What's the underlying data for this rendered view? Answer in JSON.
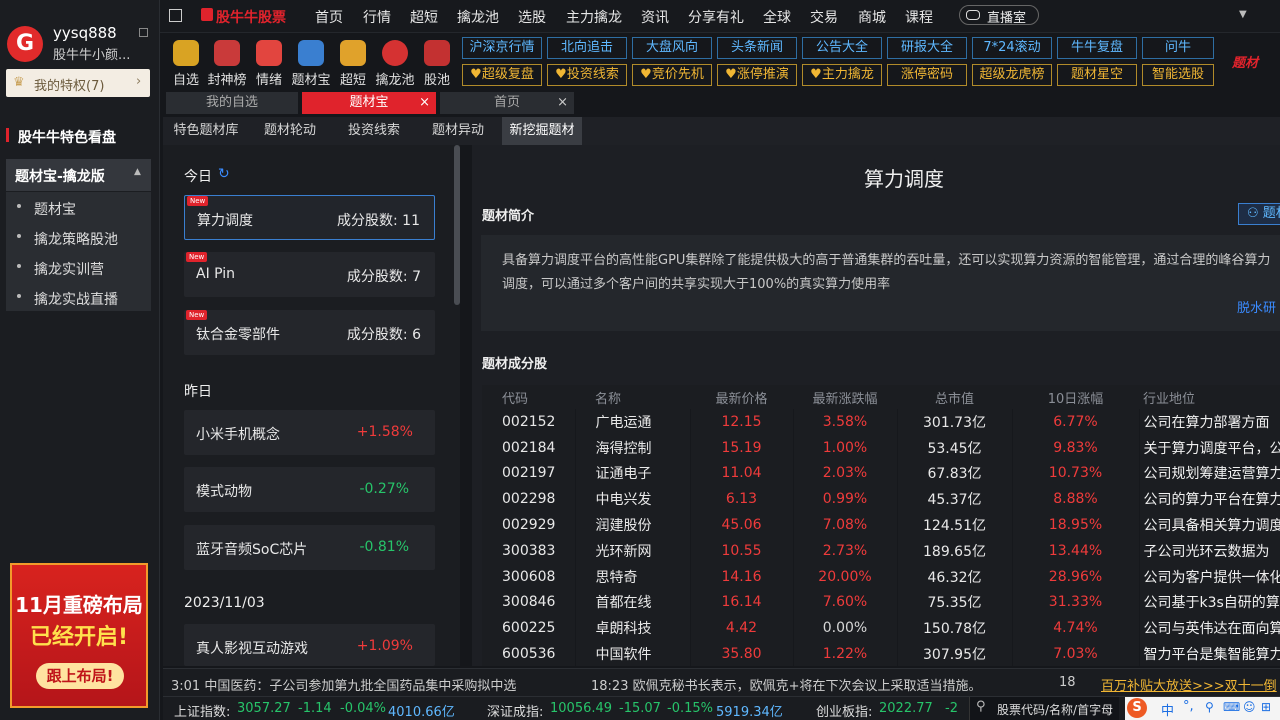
{
  "user": {
    "name": "yysq888",
    "subtitle": "股牛牛小颜...",
    "privilege": "我的特权(7)"
  },
  "sidebar": {
    "section_title": "股牛牛特色看盘",
    "group": "题材宝-擒龙版",
    "items": [
      "题材宝",
      "擒龙策略股池",
      "擒龙实训营",
      "擒龙实战直播"
    ]
  },
  "ad": {
    "line1": "11月重磅布局",
    "line2": "已经开启!",
    "button": "跟上布局!"
  },
  "brand": "股牛牛股票",
  "nav": [
    "首页",
    "行情",
    "超短",
    "擒龙池",
    "选股",
    "主力擒龙",
    "资讯",
    "分享有礼",
    "全球",
    "交易",
    "商城",
    "课程"
  ],
  "live": "直播室",
  "quick": [
    "自选",
    "封神榜",
    "情绪",
    "题材宝",
    "超短",
    "擒龙池",
    "股池"
  ],
  "blue_buttons": [
    "沪深京行情",
    "北向追击",
    "大盘风向",
    "头条新闻",
    "公告大全",
    "研报大全",
    "7*24滚动",
    "牛牛复盘",
    "问牛"
  ],
  "gold_buttons": [
    "超级复盘",
    "投资线索",
    "竞价先机",
    "涨停推演",
    "主力擒龙",
    "涨停密码",
    "超级龙虎榜",
    "题材星空",
    "智能选股"
  ],
  "brand_tag": "题材",
  "tabs": [
    "我的自选",
    "题材宝",
    "首页"
  ],
  "subtabs": [
    "特色题材库",
    "题材轮动",
    "投资线索",
    "题材异动",
    "新挖掘题材"
  ],
  "list": {
    "today_label": "今日",
    "today": [
      {
        "name": "算力调度",
        "count": "成分股数: 11",
        "badge": "New"
      },
      {
        "name": "AI Pin",
        "count": "成分股数: 7",
        "badge": "New"
      },
      {
        "name": "钛合金零部件",
        "count": "成分股数: 6",
        "badge": "New"
      }
    ],
    "yesterday_label": "昨日",
    "yesterday": [
      {
        "name": "小米手机概念",
        "change": "+1.58%"
      },
      {
        "name": "模式动物",
        "change": "-0.27%"
      },
      {
        "name": "蓝牙音频SoC芯片",
        "change": "-0.81%"
      }
    ],
    "date_label": "2023/11/03",
    "dated": [
      {
        "name": "真人影视互动游戏",
        "change": "+1.09%"
      }
    ]
  },
  "detail": {
    "title": "算力调度",
    "intro_label": "题材简介",
    "intro_tag": "题材",
    "intro_text": "具备算力调度平台的高性能GPU集群除了能提供极大的高于普通集群的吞吐量，还可以实现算力资源的智能管理，通过合理的峰谷算力调度，可以通过多个客户间的共享实现大于100%的真实算力使用率",
    "intro_source": "脱水研",
    "stocks_label": "题材成分股",
    "columns": [
      "代码",
      "名称",
      "最新价格",
      "最新涨跌幅",
      "总市值",
      "10日涨幅",
      "行业地位"
    ],
    "rows": [
      [
        "002152",
        "广电运通",
        "12.15",
        "3.58%",
        "301.73亿",
        "6.77%",
        "公司在算力部署方面"
      ],
      [
        "002184",
        "海得控制",
        "15.19",
        "1.00%",
        "53.45亿",
        "9.83%",
        "关于算力调度平台，公"
      ],
      [
        "002197",
        "证通电子",
        "11.04",
        "2.03%",
        "67.83亿",
        "10.73%",
        "公司规划筹建运营算力"
      ],
      [
        "002298",
        "中电兴发",
        "6.13",
        "0.99%",
        "45.37亿",
        "8.88%",
        "公司的算力平台在算力"
      ],
      [
        "002929",
        "润建股份",
        "45.06",
        "7.08%",
        "124.51亿",
        "18.95%",
        "公司具备相关算力调度"
      ],
      [
        "300383",
        "光环新网",
        "10.55",
        "2.73%",
        "189.65亿",
        "13.44%",
        "子公司光环云数据为"
      ],
      [
        "300608",
        "思特奇",
        "14.16",
        "20.00%",
        "46.32亿",
        "28.96%",
        "公司为客户提供一体化"
      ],
      [
        "300846",
        "首都在线",
        "16.14",
        "7.60%",
        "75.35亿",
        "31.33%",
        "公司基于k3s自研的算"
      ],
      [
        "600225",
        "卓朗科技",
        "4.42",
        "0.00%",
        "150.78亿",
        "4.74%",
        "公司与英伟达在面向算"
      ],
      [
        "600536",
        "中国软件",
        "35.80",
        "1.22%",
        "307.95亿",
        "7.03%",
        "智力平台是集智能算力"
      ]
    ]
  },
  "ticker": {
    "item1": "3:01 中国医药：子公司参加第九批全国药品集中采购拟中选",
    "item2": "18:23 欧佩克秘书长表示，欧佩克+将在下次会议上采取适当措施。",
    "item3": "18",
    "promo": "百万补贴大放送>>>双十一倒"
  },
  "status": {
    "sh_label": "上证指数:",
    "sh_value": "3057.27",
    "sh_change": "-1.14",
    "sh_pct": "-0.04%",
    "sh_amount": "4010.66亿",
    "sz_label": "深证成指:",
    "sz_value": "10056.49",
    "sz_change": "-15.07",
    "sz_pct": "-0.15%",
    "sz_amount": "5919.34亿",
    "cy_label": "创业板指:",
    "cy_value": "2022.77",
    "cy_change": "-2",
    "search_placeholder": "股票代码/名称/首字母",
    "ime": "中"
  },
  "colors": {
    "red": "#ef3b3b",
    "green": "#27c46a",
    "blue": "#5fb8ff",
    "gold": "#f0b634"
  }
}
